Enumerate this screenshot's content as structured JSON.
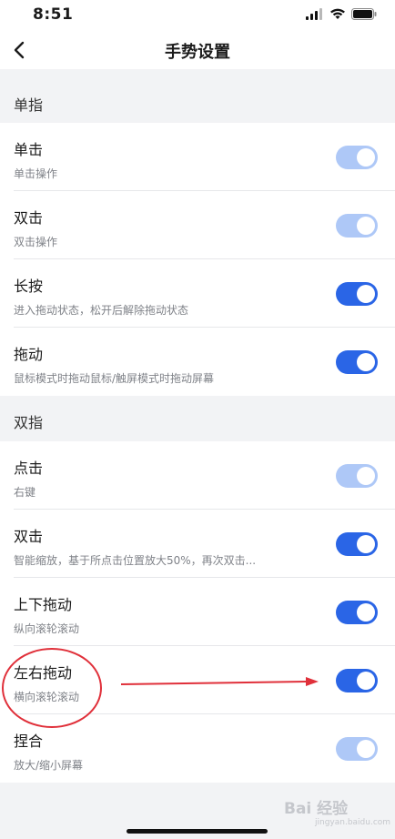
{
  "status_bar": {
    "time": "8:51"
  },
  "header": {
    "title": "手势设置"
  },
  "sections": [
    {
      "header": "单指",
      "items": [
        {
          "title": "单击",
          "subtitle": "单击操作",
          "toggle": "on-disabled"
        },
        {
          "title": "双击",
          "subtitle": "双击操作",
          "toggle": "on-disabled"
        },
        {
          "title": "长按",
          "subtitle": "进入拖动状态，松开后解除拖动状态",
          "toggle": "on"
        },
        {
          "title": "拖动",
          "subtitle": "鼠标模式时拖动鼠标/触屏模式时拖动屏幕",
          "toggle": "on"
        }
      ]
    },
    {
      "header": "双指",
      "items": [
        {
          "title": "点击",
          "subtitle": "右键",
          "toggle": "on-disabled"
        },
        {
          "title": "双击",
          "subtitle": "智能缩放，基于所点击位置放大50%，再次双击...",
          "toggle": "on"
        },
        {
          "title": "上下拖动",
          "subtitle": "纵向滚轮滚动",
          "toggle": "on"
        },
        {
          "title": "左右拖动",
          "subtitle": "横向滚轮滚动",
          "toggle": "on"
        },
        {
          "title": "捏合",
          "subtitle": "放大/缩小屏幕",
          "toggle": "on-disabled"
        }
      ]
    }
  ],
  "watermark": {
    "text": "Bai 经验",
    "sub": "jingyan.baidu.com"
  },
  "colors": {
    "toggle_on": "#2a65e6",
    "toggle_on_disabled": "#aec8f7",
    "annotation": "#e0303a",
    "background": "#f2f3f5"
  }
}
